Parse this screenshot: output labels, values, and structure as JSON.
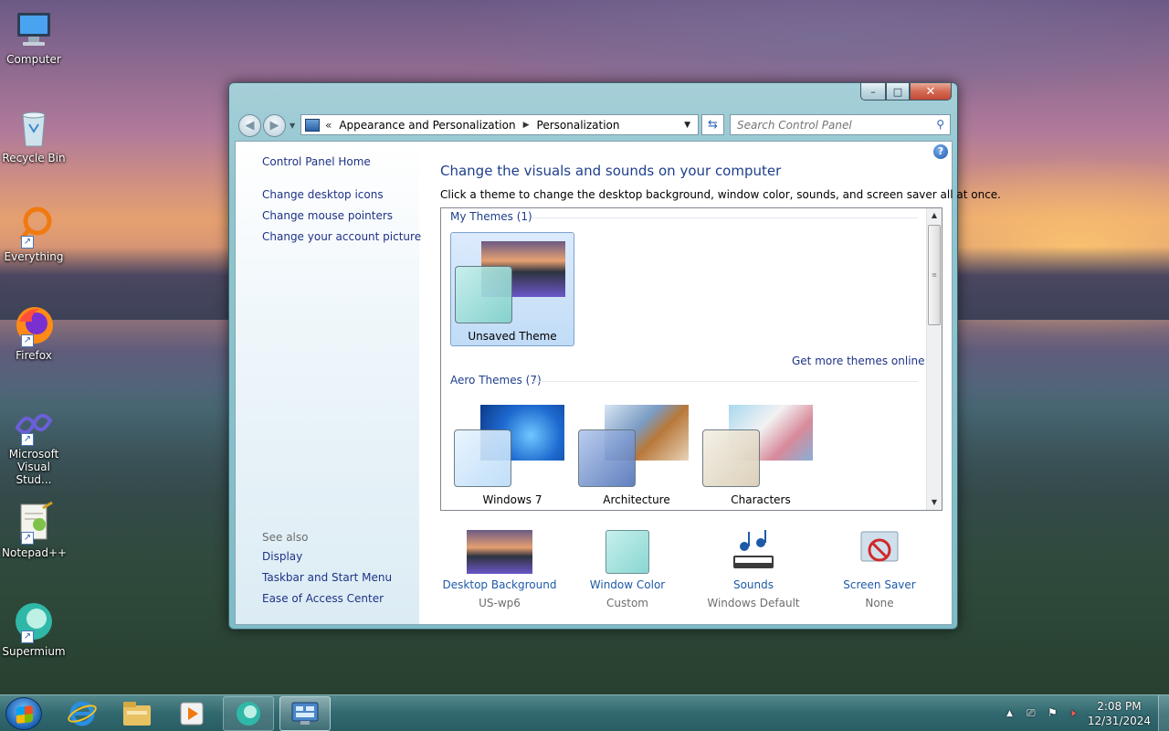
{
  "desktop": {
    "icons": [
      {
        "label": "Computer"
      },
      {
        "label": "Recycle Bin"
      },
      {
        "label": "Everything"
      },
      {
        "label": "Firefox"
      },
      {
        "label": "Microsoft Visual Stud..."
      },
      {
        "label": "Notepad++"
      },
      {
        "label": "Supermium"
      }
    ]
  },
  "window": {
    "controls": {
      "minimize": "–",
      "maximize": "□",
      "close": "✕"
    },
    "address": {
      "chevron": "«",
      "crumbs": [
        "Appearance and Personalization",
        "Personalization"
      ]
    },
    "search": {
      "placeholder": "Search Control Panel"
    },
    "help_glyph": "?",
    "sidebar": {
      "home": "Control Panel Home",
      "links": [
        "Change desktop icons",
        "Change mouse pointers",
        "Change your account picture"
      ],
      "see_also_title": "See also",
      "see_also": [
        "Display",
        "Taskbar and Start Menu",
        "Ease of Access Center"
      ]
    },
    "main": {
      "title": "Change the visuals and sounds on your computer",
      "subtitle": "Click a theme to change the desktop background, window color, sounds, and screen saver all at once.",
      "my_themes_header": "My Themes (1)",
      "my_themes": [
        {
          "name": "Unsaved Theme",
          "selected": true
        }
      ],
      "get_more": "Get more themes online",
      "aero_header": "Aero Themes (7)",
      "aero_themes": [
        {
          "name": "Windows 7"
        },
        {
          "name": "Architecture"
        },
        {
          "name": "Characters"
        }
      ]
    },
    "bottom": [
      {
        "label": "Desktop Background",
        "value": "US-wp6",
        "icon": "landscape-icon"
      },
      {
        "label": "Window Color",
        "value": "Custom",
        "icon": "color-swatch-icon"
      },
      {
        "label": "Sounds",
        "value": "Windows Default",
        "icon": "music-notes-icon"
      },
      {
        "label": "Screen Saver",
        "value": "None",
        "icon": "screen-saver-icon"
      }
    ]
  },
  "taskbar": {
    "pinned": [
      "internet-explorer-icon",
      "file-explorer-icon",
      "media-player-icon",
      "supermium-icon",
      "control-panel-icon"
    ],
    "tray_expand": "▲",
    "clock": {
      "time": "2:08 PM",
      "date": "12/31/2024"
    }
  },
  "colors": {
    "link": "#1e3287",
    "title_blue": "#1e3f8c",
    "window_frame": "#7dbcc6",
    "window_color_swatch": "#9ad9d6"
  }
}
